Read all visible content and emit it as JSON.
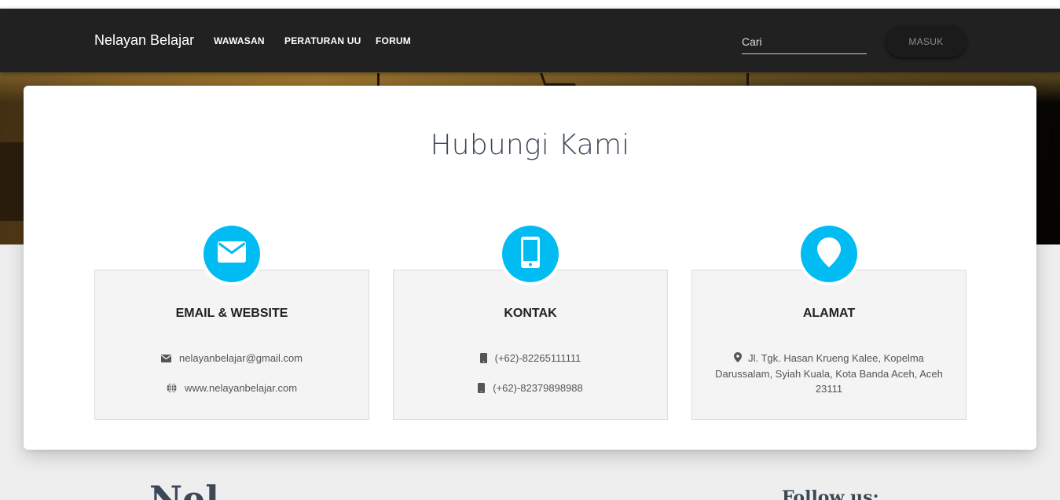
{
  "navbar": {
    "brand": "Nelayan Belajar",
    "items": [
      {
        "label": "WAWASAN"
      },
      {
        "label": "PERATURAN UU"
      },
      {
        "label": "FORUM"
      }
    ],
    "search_placeholder": "Cari",
    "login_label": "MASUK"
  },
  "contact": {
    "title": "Hubungi Kami",
    "accent_color": "#00bcf2",
    "cards": [
      {
        "icon": "envelope-icon",
        "title": "EMAIL & WEBSITE",
        "lines": [
          {
            "icon": "envelope-icon",
            "text": "nelayanbelajar@gmail.com"
          },
          {
            "icon": "globe-icon",
            "text": "www.nelayanbelajar.com"
          }
        ]
      },
      {
        "icon": "mobile-phone-icon",
        "title": "KONTAK",
        "lines": [
          {
            "icon": "mobile-phone-icon",
            "text": "(+62)-82265111111"
          },
          {
            "icon": "mobile-phone-icon",
            "text": "(+62)-82379898988"
          }
        ]
      },
      {
        "icon": "map-marker-icon",
        "title": "ALAMAT",
        "address_icon": "map-marker-icon",
        "address": "Jl. Tgk. Hasan Krueng Kalee, Kopelma Darussalam, Syiah Kuala, Kota Banda Aceh, Aceh 23111"
      }
    ]
  },
  "footer": {
    "brand_partial": "Nel",
    "follow_label": "Follow us:"
  }
}
